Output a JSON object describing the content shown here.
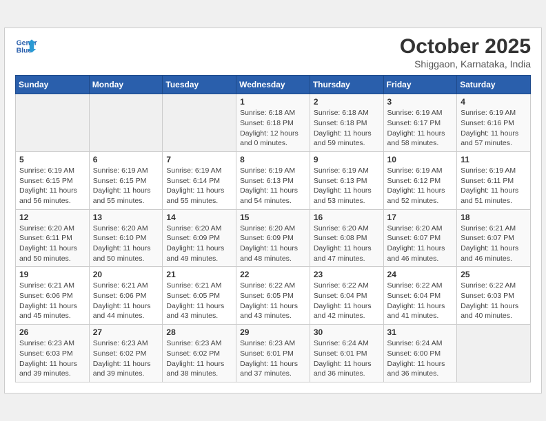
{
  "header": {
    "logo_line1": "General",
    "logo_line2": "Blue",
    "month_title": "October 2025",
    "location": "Shiggaon, Karnataka, India"
  },
  "weekdays": [
    "Sunday",
    "Monday",
    "Tuesday",
    "Wednesday",
    "Thursday",
    "Friday",
    "Saturday"
  ],
  "weeks": [
    [
      {
        "day": "",
        "info": ""
      },
      {
        "day": "",
        "info": ""
      },
      {
        "day": "",
        "info": ""
      },
      {
        "day": "1",
        "info": "Sunrise: 6:18 AM\nSunset: 6:18 PM\nDaylight: 12 hours\nand 0 minutes."
      },
      {
        "day": "2",
        "info": "Sunrise: 6:18 AM\nSunset: 6:18 PM\nDaylight: 11 hours\nand 59 minutes."
      },
      {
        "day": "3",
        "info": "Sunrise: 6:19 AM\nSunset: 6:17 PM\nDaylight: 11 hours\nand 58 minutes."
      },
      {
        "day": "4",
        "info": "Sunrise: 6:19 AM\nSunset: 6:16 PM\nDaylight: 11 hours\nand 57 minutes."
      }
    ],
    [
      {
        "day": "5",
        "info": "Sunrise: 6:19 AM\nSunset: 6:15 PM\nDaylight: 11 hours\nand 56 minutes."
      },
      {
        "day": "6",
        "info": "Sunrise: 6:19 AM\nSunset: 6:15 PM\nDaylight: 11 hours\nand 55 minutes."
      },
      {
        "day": "7",
        "info": "Sunrise: 6:19 AM\nSunset: 6:14 PM\nDaylight: 11 hours\nand 55 minutes."
      },
      {
        "day": "8",
        "info": "Sunrise: 6:19 AM\nSunset: 6:13 PM\nDaylight: 11 hours\nand 54 minutes."
      },
      {
        "day": "9",
        "info": "Sunrise: 6:19 AM\nSunset: 6:13 PM\nDaylight: 11 hours\nand 53 minutes."
      },
      {
        "day": "10",
        "info": "Sunrise: 6:19 AM\nSunset: 6:12 PM\nDaylight: 11 hours\nand 52 minutes."
      },
      {
        "day": "11",
        "info": "Sunrise: 6:19 AM\nSunset: 6:11 PM\nDaylight: 11 hours\nand 51 minutes."
      }
    ],
    [
      {
        "day": "12",
        "info": "Sunrise: 6:20 AM\nSunset: 6:11 PM\nDaylight: 11 hours\nand 50 minutes."
      },
      {
        "day": "13",
        "info": "Sunrise: 6:20 AM\nSunset: 6:10 PM\nDaylight: 11 hours\nand 50 minutes."
      },
      {
        "day": "14",
        "info": "Sunrise: 6:20 AM\nSunset: 6:09 PM\nDaylight: 11 hours\nand 49 minutes."
      },
      {
        "day": "15",
        "info": "Sunrise: 6:20 AM\nSunset: 6:09 PM\nDaylight: 11 hours\nand 48 minutes."
      },
      {
        "day": "16",
        "info": "Sunrise: 6:20 AM\nSunset: 6:08 PM\nDaylight: 11 hours\nand 47 minutes."
      },
      {
        "day": "17",
        "info": "Sunrise: 6:20 AM\nSunset: 6:07 PM\nDaylight: 11 hours\nand 46 minutes."
      },
      {
        "day": "18",
        "info": "Sunrise: 6:21 AM\nSunset: 6:07 PM\nDaylight: 11 hours\nand 46 minutes."
      }
    ],
    [
      {
        "day": "19",
        "info": "Sunrise: 6:21 AM\nSunset: 6:06 PM\nDaylight: 11 hours\nand 45 minutes."
      },
      {
        "day": "20",
        "info": "Sunrise: 6:21 AM\nSunset: 6:06 PM\nDaylight: 11 hours\nand 44 minutes."
      },
      {
        "day": "21",
        "info": "Sunrise: 6:21 AM\nSunset: 6:05 PM\nDaylight: 11 hours\nand 43 minutes."
      },
      {
        "day": "22",
        "info": "Sunrise: 6:22 AM\nSunset: 6:05 PM\nDaylight: 11 hours\nand 43 minutes."
      },
      {
        "day": "23",
        "info": "Sunrise: 6:22 AM\nSunset: 6:04 PM\nDaylight: 11 hours\nand 42 minutes."
      },
      {
        "day": "24",
        "info": "Sunrise: 6:22 AM\nSunset: 6:04 PM\nDaylight: 11 hours\nand 41 minutes."
      },
      {
        "day": "25",
        "info": "Sunrise: 6:22 AM\nSunset: 6:03 PM\nDaylight: 11 hours\nand 40 minutes."
      }
    ],
    [
      {
        "day": "26",
        "info": "Sunrise: 6:23 AM\nSunset: 6:03 PM\nDaylight: 11 hours\nand 39 minutes."
      },
      {
        "day": "27",
        "info": "Sunrise: 6:23 AM\nSunset: 6:02 PM\nDaylight: 11 hours\nand 39 minutes."
      },
      {
        "day": "28",
        "info": "Sunrise: 6:23 AM\nSunset: 6:02 PM\nDaylight: 11 hours\nand 38 minutes."
      },
      {
        "day": "29",
        "info": "Sunrise: 6:23 AM\nSunset: 6:01 PM\nDaylight: 11 hours\nand 37 minutes."
      },
      {
        "day": "30",
        "info": "Sunrise: 6:24 AM\nSunset: 6:01 PM\nDaylight: 11 hours\nand 36 minutes."
      },
      {
        "day": "31",
        "info": "Sunrise: 6:24 AM\nSunset: 6:00 PM\nDaylight: 11 hours\nand 36 minutes."
      },
      {
        "day": "",
        "info": ""
      }
    ]
  ]
}
